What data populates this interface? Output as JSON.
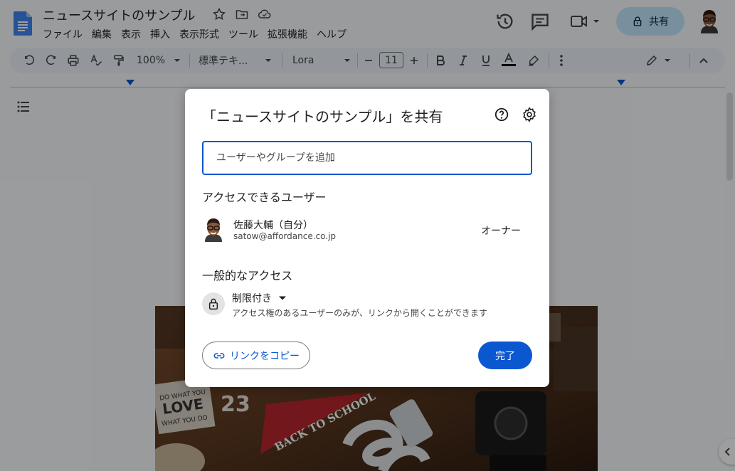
{
  "document": {
    "title": "ニュースサイトのサンプル"
  },
  "menu": [
    "ファイル",
    "編集",
    "表示",
    "挿入",
    "表示形式",
    "ツール",
    "拡張機能",
    "ヘルプ"
  ],
  "header": {
    "share_label": "共有"
  },
  "toolbar": {
    "zoom": "100%",
    "style": "標準テキ...",
    "font": "Lora",
    "font_size": "11"
  },
  "photo": {
    "pennant_text": "BACK TO SCHOOL",
    "sign_line1": "DO WHAT YOU",
    "sign_line2": "LOVE",
    "sign_line3": "WHAT YOU DO",
    "number": "23"
  },
  "share_dialog": {
    "title": "「ニュースサイトのサンプル」を共有",
    "add_placeholder": "ユーザーやグループを追加",
    "people_heading": "アクセスできるユーザー",
    "user": {
      "name": "佐藤大輔（自分）",
      "email": "satow@affordance.co.jp",
      "role": "オーナー"
    },
    "general_heading": "一般的なアクセス",
    "access_level": "制限付き",
    "access_description": "アクセス権のあるユーザーのみが、リンクから開くことができます",
    "copy_link_label": "リンクをコピー",
    "done_label": "完了"
  },
  "colors": {
    "accent": "#0b57d0",
    "share_bg": "#c2e7ff",
    "toolbar_bg": "#edf2fa"
  }
}
